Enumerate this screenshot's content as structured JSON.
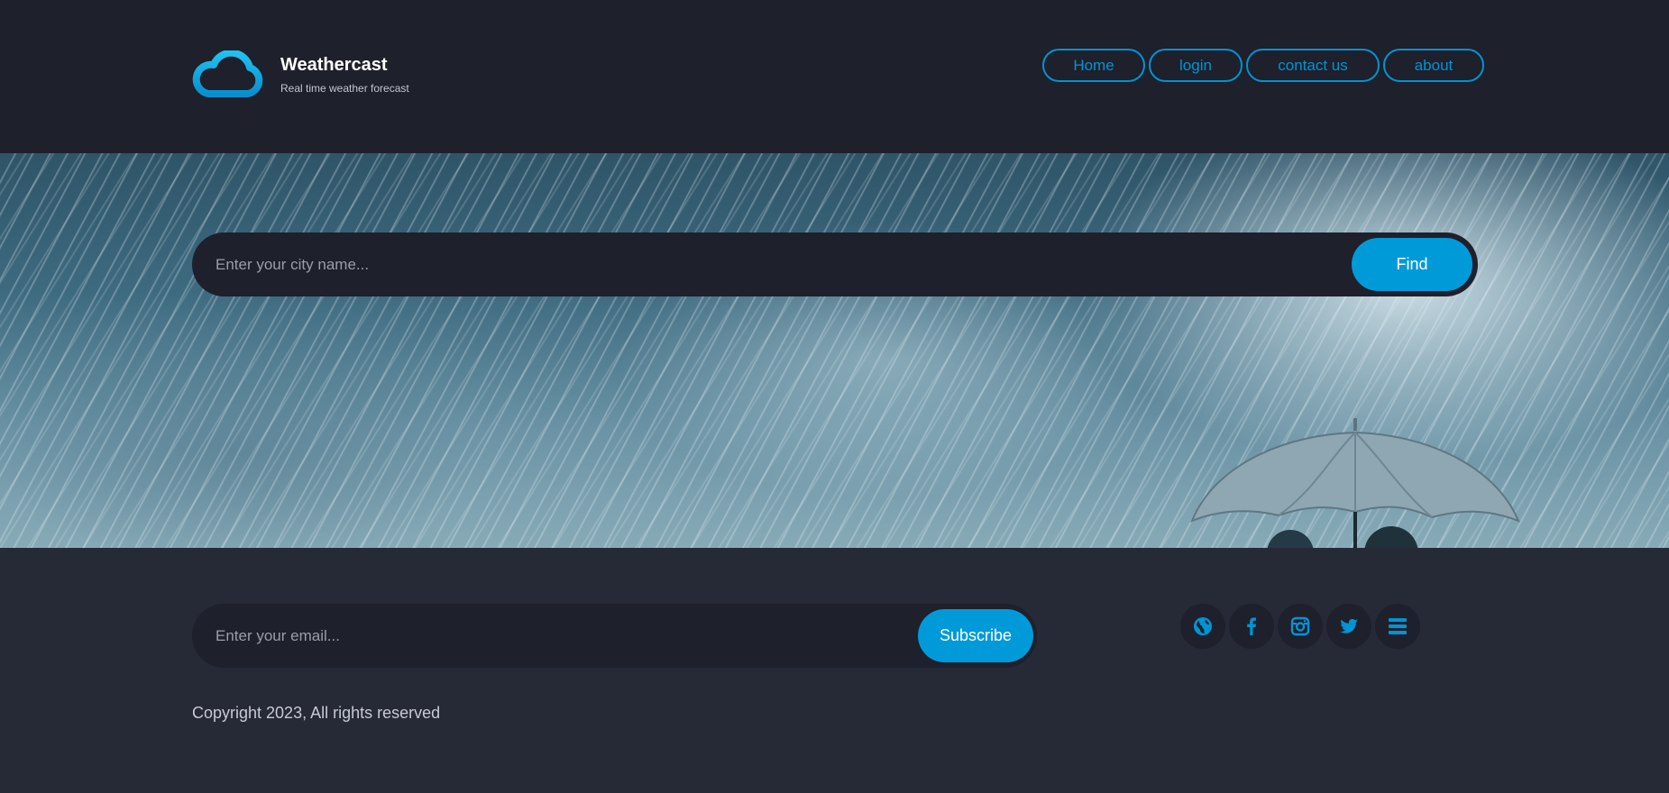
{
  "brand": {
    "title": "Weathercast",
    "tagline": "Real time weather forecast",
    "logo_icon": "cloud-icon"
  },
  "nav": {
    "items": [
      {
        "label": "Home"
      },
      {
        "label": "login"
      },
      {
        "label": "contact us"
      },
      {
        "label": "about"
      }
    ]
  },
  "search": {
    "placeholder": "Enter your city name...",
    "value": "",
    "button_label": "Find"
  },
  "subscribe": {
    "placeholder": "Enter your email...",
    "value": "",
    "button_label": "Subscribe"
  },
  "social": {
    "icons": [
      "globe-icon",
      "facebook-icon",
      "instagram-icon",
      "twitter-icon",
      "menu-icon"
    ]
  },
  "footer": {
    "copyright": "Copyright 2023, All rights reserved"
  },
  "colors": {
    "accent": "#009ad9",
    "header_bg": "#1e202c",
    "footer_bg": "#262936",
    "text_light": "#ffffff",
    "text_muted": "#c7cad3"
  }
}
